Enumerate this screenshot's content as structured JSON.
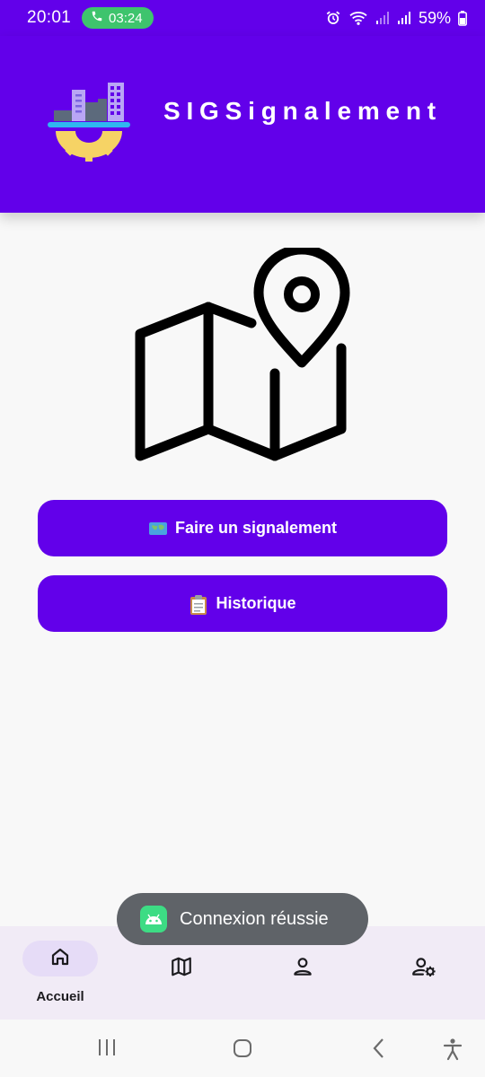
{
  "status_bar": {
    "time": "20:01",
    "call_duration": "03:24",
    "battery": "59%",
    "icons": [
      "phone-icon",
      "alarm-icon",
      "wifi-icon",
      "signal-icon",
      "signal-icon",
      "battery-icon"
    ]
  },
  "header": {
    "title": "SIGSignalement",
    "logo": "city-gear-logo"
  },
  "illustration": "map-pin-icon",
  "actions": {
    "report": {
      "emoji": "🗺️",
      "label": "Faire un signalement"
    },
    "history": {
      "emoji": "📋",
      "label": "Historique"
    }
  },
  "toast": {
    "message": "Connexion réussie",
    "icon": "android-icon"
  },
  "bottom_nav": {
    "items": [
      {
        "label": "Accueil",
        "icon": "home-icon",
        "active": true
      },
      {
        "label": "",
        "icon": "map-icon",
        "active": false
      },
      {
        "label": "",
        "icon": "person-icon",
        "active": false
      },
      {
        "label": "",
        "icon": "person-settings-icon",
        "active": false
      }
    ]
  },
  "system_nav": [
    "recent-apps-icon",
    "home-circle-icon",
    "back-icon",
    "accessibility-icon"
  ],
  "colors": {
    "primary": "#6200ea",
    "call_pill": "#3ec46d",
    "toast_bg": "#5f6368",
    "nav_bg": "#f1ebf6",
    "nav_active_pill": "#e6dcf7",
    "logo_gear": "#f6d365",
    "logo_platform": "#2fb7f0"
  }
}
